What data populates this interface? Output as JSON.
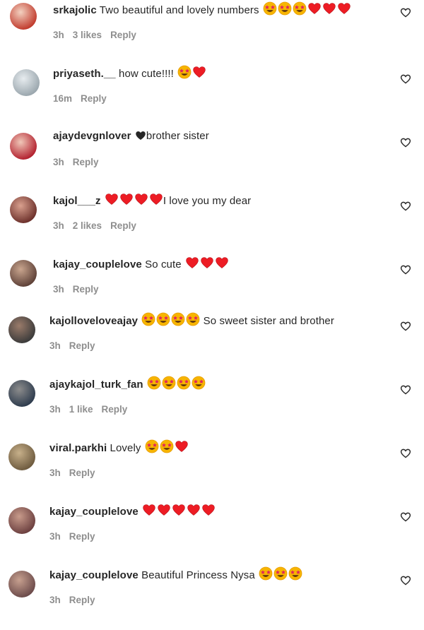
{
  "comments": [
    {
      "username": "srkajolic",
      "text": "Two beautiful and lovely numbers",
      "emojis": [
        "star-eyes",
        "star-eyes",
        "star-eyes",
        "red-heart",
        "red-heart",
        "red-heart"
      ],
      "emoji_first": false,
      "time": "3h",
      "likes": "3 likes",
      "reply": "Reply"
    },
    {
      "username": "priyaseth.__",
      "text": "how cute!!!!",
      "emojis": [
        "star-eyes",
        "red-heart"
      ],
      "emoji_first": false,
      "time": "16m",
      "likes": "",
      "reply": "Reply"
    },
    {
      "username": "ajaydevgnlover",
      "text": "brother sister",
      "emojis": [
        "black-heart"
      ],
      "emoji_first": true,
      "time": "3h",
      "likes": "",
      "reply": "Reply"
    },
    {
      "username": "kajol___z",
      "text": "I love you my dear",
      "emojis": [
        "red-heart",
        "red-heart",
        "red-heart",
        "red-heart"
      ],
      "emoji_first": true,
      "time": "3h",
      "likes": "2 likes",
      "reply": "Reply"
    },
    {
      "username": "kajay_couplelove",
      "text": "So cute",
      "emojis": [
        "red-heart",
        "red-heart",
        "red-heart"
      ],
      "emoji_first": false,
      "time": "3h",
      "likes": "",
      "reply": "Reply"
    },
    {
      "username": "kajolloveloveajay",
      "text": "So sweet sister and brother",
      "emojis": [
        "star-eyes",
        "star-eyes",
        "star-eyes",
        "star-eyes"
      ],
      "emoji_first": true,
      "time": "3h",
      "likes": "",
      "reply": "Reply"
    },
    {
      "username": "ajaykajol_turk_fan",
      "text": "",
      "emojis": [
        "star-eyes",
        "star-eyes",
        "star-eyes",
        "star-eyes"
      ],
      "emoji_first": false,
      "time": "3h",
      "likes": "1 like",
      "reply": "Reply"
    },
    {
      "username": "viral.parkhi",
      "text": "Lovely",
      "emojis": [
        "star-eyes",
        "star-eyes",
        "red-heart"
      ],
      "emoji_first": false,
      "time": "3h",
      "likes": "",
      "reply": "Reply"
    },
    {
      "username": "kajay_couplelove",
      "text": "",
      "emojis": [
        "red-heart",
        "red-heart",
        "red-heart",
        "red-heart",
        "red-heart"
      ],
      "emoji_first": false,
      "time": "3h",
      "likes": "",
      "reply": "Reply"
    },
    {
      "username": "kajay_couplelove",
      "text": "Beautiful Princess Nysa",
      "emojis": [
        "star-eyes",
        "star-eyes",
        "star-eyes"
      ],
      "emoji_first": false,
      "time": "3h",
      "likes": "",
      "reply": "Reply"
    }
  ],
  "icons": {
    "like": "heart-outline-icon"
  },
  "colors": {
    "username": "#262626",
    "meta": "#8e8e8e",
    "heart": "#ed1c24",
    "emoji_face": "#f7b500"
  }
}
